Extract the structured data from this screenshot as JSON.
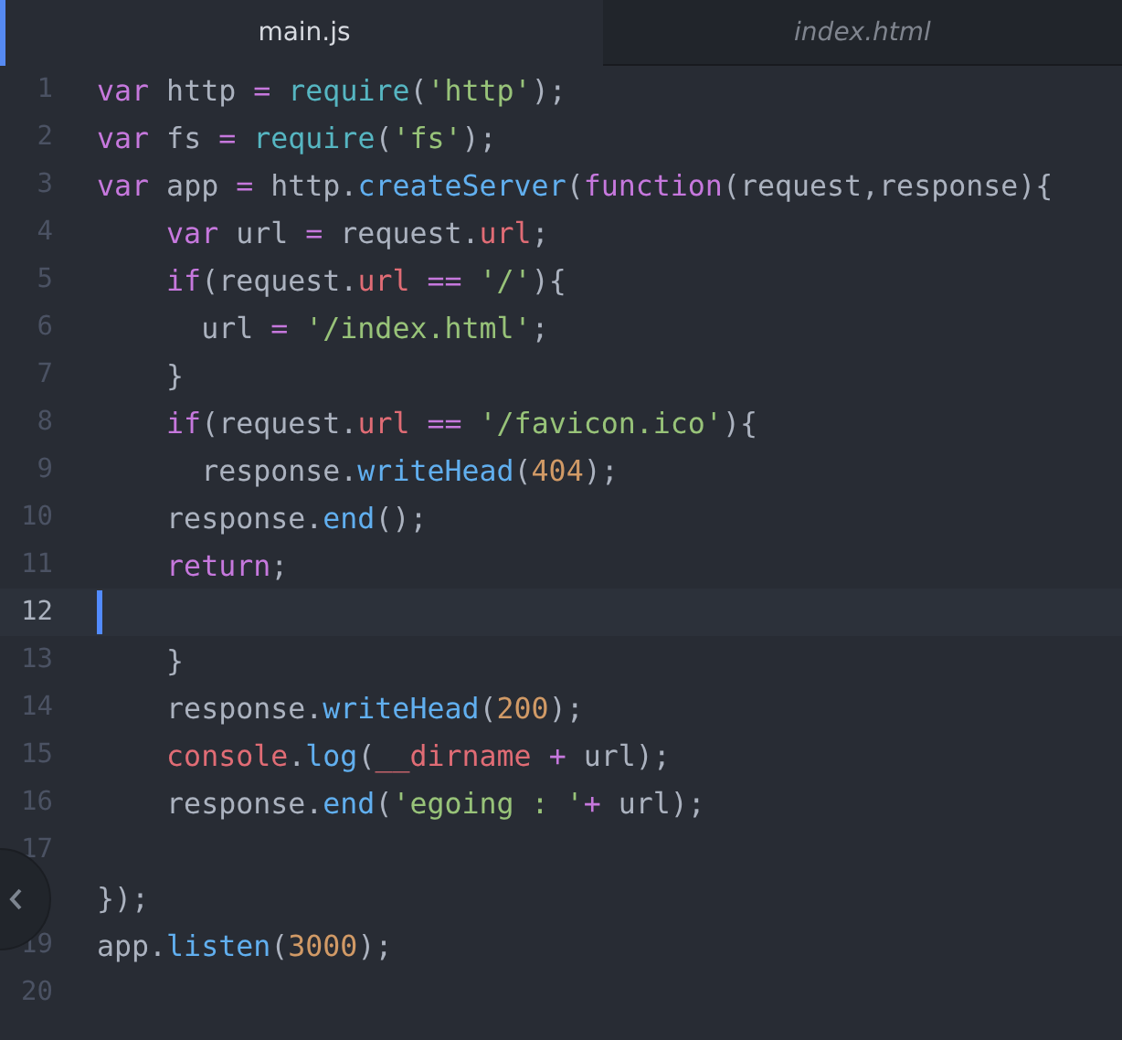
{
  "tabs": [
    {
      "label": "main.js",
      "selected": true
    },
    {
      "label": "index.html",
      "selected": false
    }
  ],
  "lines": [
    {
      "number": "1",
      "current": false,
      "tokens": [
        {
          "kind": "kw",
          "text": "var"
        },
        {
          "kind": "pl",
          "text": " http "
        },
        {
          "kind": "op",
          "text": "= "
        },
        {
          "kind": "bi",
          "text": "require"
        },
        {
          "kind": "pl",
          "text": "("
        },
        {
          "kind": "str",
          "text": "'http'"
        },
        {
          "kind": "pl",
          "text": ");"
        }
      ]
    },
    {
      "number": "2",
      "current": false,
      "tokens": [
        {
          "kind": "kw",
          "text": "var"
        },
        {
          "kind": "pl",
          "text": " fs "
        },
        {
          "kind": "op",
          "text": "= "
        },
        {
          "kind": "bi",
          "text": "require"
        },
        {
          "kind": "pl",
          "text": "("
        },
        {
          "kind": "str",
          "text": "'fs'"
        },
        {
          "kind": "pl",
          "text": ");"
        }
      ]
    },
    {
      "number": "3",
      "current": false,
      "tokens": [
        {
          "kind": "kw",
          "text": "var"
        },
        {
          "kind": "pl",
          "text": " app "
        },
        {
          "kind": "op",
          "text": "="
        },
        {
          "kind": "pl",
          "text": " http."
        },
        {
          "kind": "fn",
          "text": "createServer"
        },
        {
          "kind": "pl",
          "text": "("
        },
        {
          "kind": "kw",
          "text": "function"
        },
        {
          "kind": "pl",
          "text": "(request,response){"
        }
      ]
    },
    {
      "number": "4",
      "current": false,
      "tokens": [
        {
          "kind": "kw",
          "text": "    var"
        },
        {
          "kind": "pl",
          "text": " url "
        },
        {
          "kind": "op",
          "text": "="
        },
        {
          "kind": "pl",
          "text": " request."
        },
        {
          "kind": "prop",
          "text": "url"
        },
        {
          "kind": "pl",
          "text": ";"
        }
      ]
    },
    {
      "number": "5",
      "current": false,
      "tokens": [
        {
          "kind": "kw",
          "text": "    if"
        },
        {
          "kind": "pl",
          "text": "(request."
        },
        {
          "kind": "prop",
          "text": "url "
        },
        {
          "kind": "op",
          "text": "== "
        },
        {
          "kind": "str",
          "text": "'/'"
        },
        {
          "kind": "pl",
          "text": "){"
        }
      ]
    },
    {
      "number": "6",
      "current": false,
      "tokens": [
        {
          "kind": "pl",
          "text": "      url "
        },
        {
          "kind": "op",
          "text": "= "
        },
        {
          "kind": "str",
          "text": "'/index.html'"
        },
        {
          "kind": "pl",
          "text": ";"
        }
      ]
    },
    {
      "number": "7",
      "current": false,
      "tokens": [
        {
          "kind": "pl",
          "text": "    }"
        }
      ]
    },
    {
      "number": "8",
      "current": false,
      "tokens": [
        {
          "kind": "kw",
          "text": "    if"
        },
        {
          "kind": "pl",
          "text": "(request."
        },
        {
          "kind": "prop",
          "text": "url "
        },
        {
          "kind": "op",
          "text": "== "
        },
        {
          "kind": "str",
          "text": "'/favicon.ico'"
        },
        {
          "kind": "pl",
          "text": "){"
        }
      ]
    },
    {
      "number": "9",
      "current": false,
      "tokens": [
        {
          "kind": "pl",
          "text": "      response."
        },
        {
          "kind": "fn",
          "text": "writeHead"
        },
        {
          "kind": "pl",
          "text": "("
        },
        {
          "kind": "num",
          "text": "404"
        },
        {
          "kind": "pl",
          "text": ");"
        }
      ]
    },
    {
      "number": "10",
      "current": false,
      "tokens": [
        {
          "kind": "pl",
          "text": "    response."
        },
        {
          "kind": "fn",
          "text": "end"
        },
        {
          "kind": "pl",
          "text": "();"
        }
      ]
    },
    {
      "number": "11",
      "current": false,
      "tokens": [
        {
          "kind": "kw",
          "text": "    return"
        },
        {
          "kind": "pl",
          "text": ";"
        }
      ]
    },
    {
      "number": "12",
      "current": true
    },
    {
      "number": "13",
      "current": false,
      "tokens": [
        {
          "kind": "pl",
          "text": "    }"
        }
      ]
    },
    {
      "number": "14",
      "current": false,
      "tokens": [
        {
          "kind": "pl",
          "text": "    response."
        },
        {
          "kind": "fn",
          "text": "writeHead"
        },
        {
          "kind": "pl",
          "text": "("
        },
        {
          "kind": "num",
          "text": "200"
        },
        {
          "kind": "pl",
          "text": ");"
        }
      ]
    },
    {
      "number": "15",
      "current": false,
      "tokens": [
        {
          "kind": "prop",
          "text": "    console"
        },
        {
          "kind": "pl",
          "text": "."
        },
        {
          "kind": "fn",
          "text": "log"
        },
        {
          "kind": "pl",
          "text": "("
        },
        {
          "kind": "prop",
          "text": "__dirname "
        },
        {
          "kind": "op",
          "text": "+"
        },
        {
          "kind": "pl",
          "text": " url);"
        }
      ]
    },
    {
      "number": "16",
      "current": false,
      "tokens": [
        {
          "kind": "pl",
          "text": "    response."
        },
        {
          "kind": "fn",
          "text": "end"
        },
        {
          "kind": "pl",
          "text": "("
        },
        {
          "kind": "str",
          "text": "'egoing : '"
        },
        {
          "kind": "op",
          "text": "+"
        },
        {
          "kind": "pl",
          "text": " url);"
        }
      ]
    },
    {
      "number": "17",
      "current": false
    },
    {
      "current": false,
      "tokens": [
        {
          "kind": "pl",
          "text": "});"
        }
      ]
    },
    {
      "number": "19",
      "current": false,
      "tokens": [
        {
          "kind": "pl",
          "text": "app."
        },
        {
          "kind": "fn",
          "text": "listen"
        },
        {
          "kind": "pl",
          "text": "("
        },
        {
          "kind": "num",
          "text": "3000"
        },
        {
          "kind": "pl",
          "text": ");"
        }
      ]
    },
    {
      "number": "20",
      "current": false
    }
  ]
}
